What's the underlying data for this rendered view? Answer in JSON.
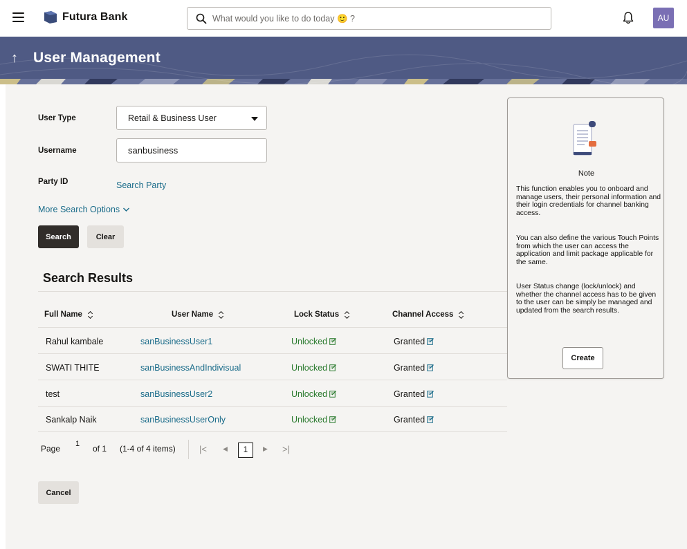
{
  "header": {
    "brand": "Futura Bank",
    "search_placeholder": "What would you like to do today 🙂 ?",
    "avatar_initials": "AU"
  },
  "banner": {
    "title": "User Management"
  },
  "form": {
    "user_type_label": "User Type",
    "user_type_value": "Retail & Business User",
    "username_label": "Username",
    "username_value": "sanbusiness",
    "party_id_label": "Party ID",
    "search_party_link": "Search Party",
    "more_options_link": "More Search Options",
    "search_button": "Search",
    "clear_button": "Clear"
  },
  "results": {
    "title": "Search Results",
    "columns": [
      "Full Name",
      "User Name",
      "Lock Status",
      "Channel Access"
    ],
    "rows": [
      {
        "full_name": "Rahul kambale",
        "user_name": "sanBusinessUser1",
        "lock_status": "Unlocked",
        "channel_access": "Granted"
      },
      {
        "full_name": "SWATI THITE",
        "user_name": "sanBusinessAndIndivisual",
        "lock_status": "Unlocked",
        "channel_access": "Granted"
      },
      {
        "full_name": "test",
        "user_name": "sanBusinessUser2",
        "lock_status": "Unlocked",
        "channel_access": "Granted"
      },
      {
        "full_name": "Sankalp Naik",
        "user_name": "sanBusinessUserOnly",
        "lock_status": "Unlocked",
        "channel_access": "Granted"
      }
    ]
  },
  "pagination": {
    "page_label": "Page",
    "current_page": "1",
    "of_label": "of 1",
    "items_label": "(1-4 of 4 items)",
    "page_button": "1"
  },
  "cancel_button": "Cancel",
  "note": {
    "title": "Note",
    "para1": "This function enables you to onboard and manage users, their personal information and their login credentials for channel banking access.",
    "para2": "You can also define the various Touch Points from which the user can access the application and limit package applicable for the same.",
    "para3": "User Status change (lock/unlock) and whether the channel access has to be given to the user can be simply be managed and updated from the search results.",
    "create_button": "Create"
  },
  "colors": {
    "banner": "#4f5a84",
    "link": "#1b6c8a",
    "status_green": "#2a7a2e",
    "primary_button": "#312d2a",
    "avatar": "#7a6fb4"
  }
}
